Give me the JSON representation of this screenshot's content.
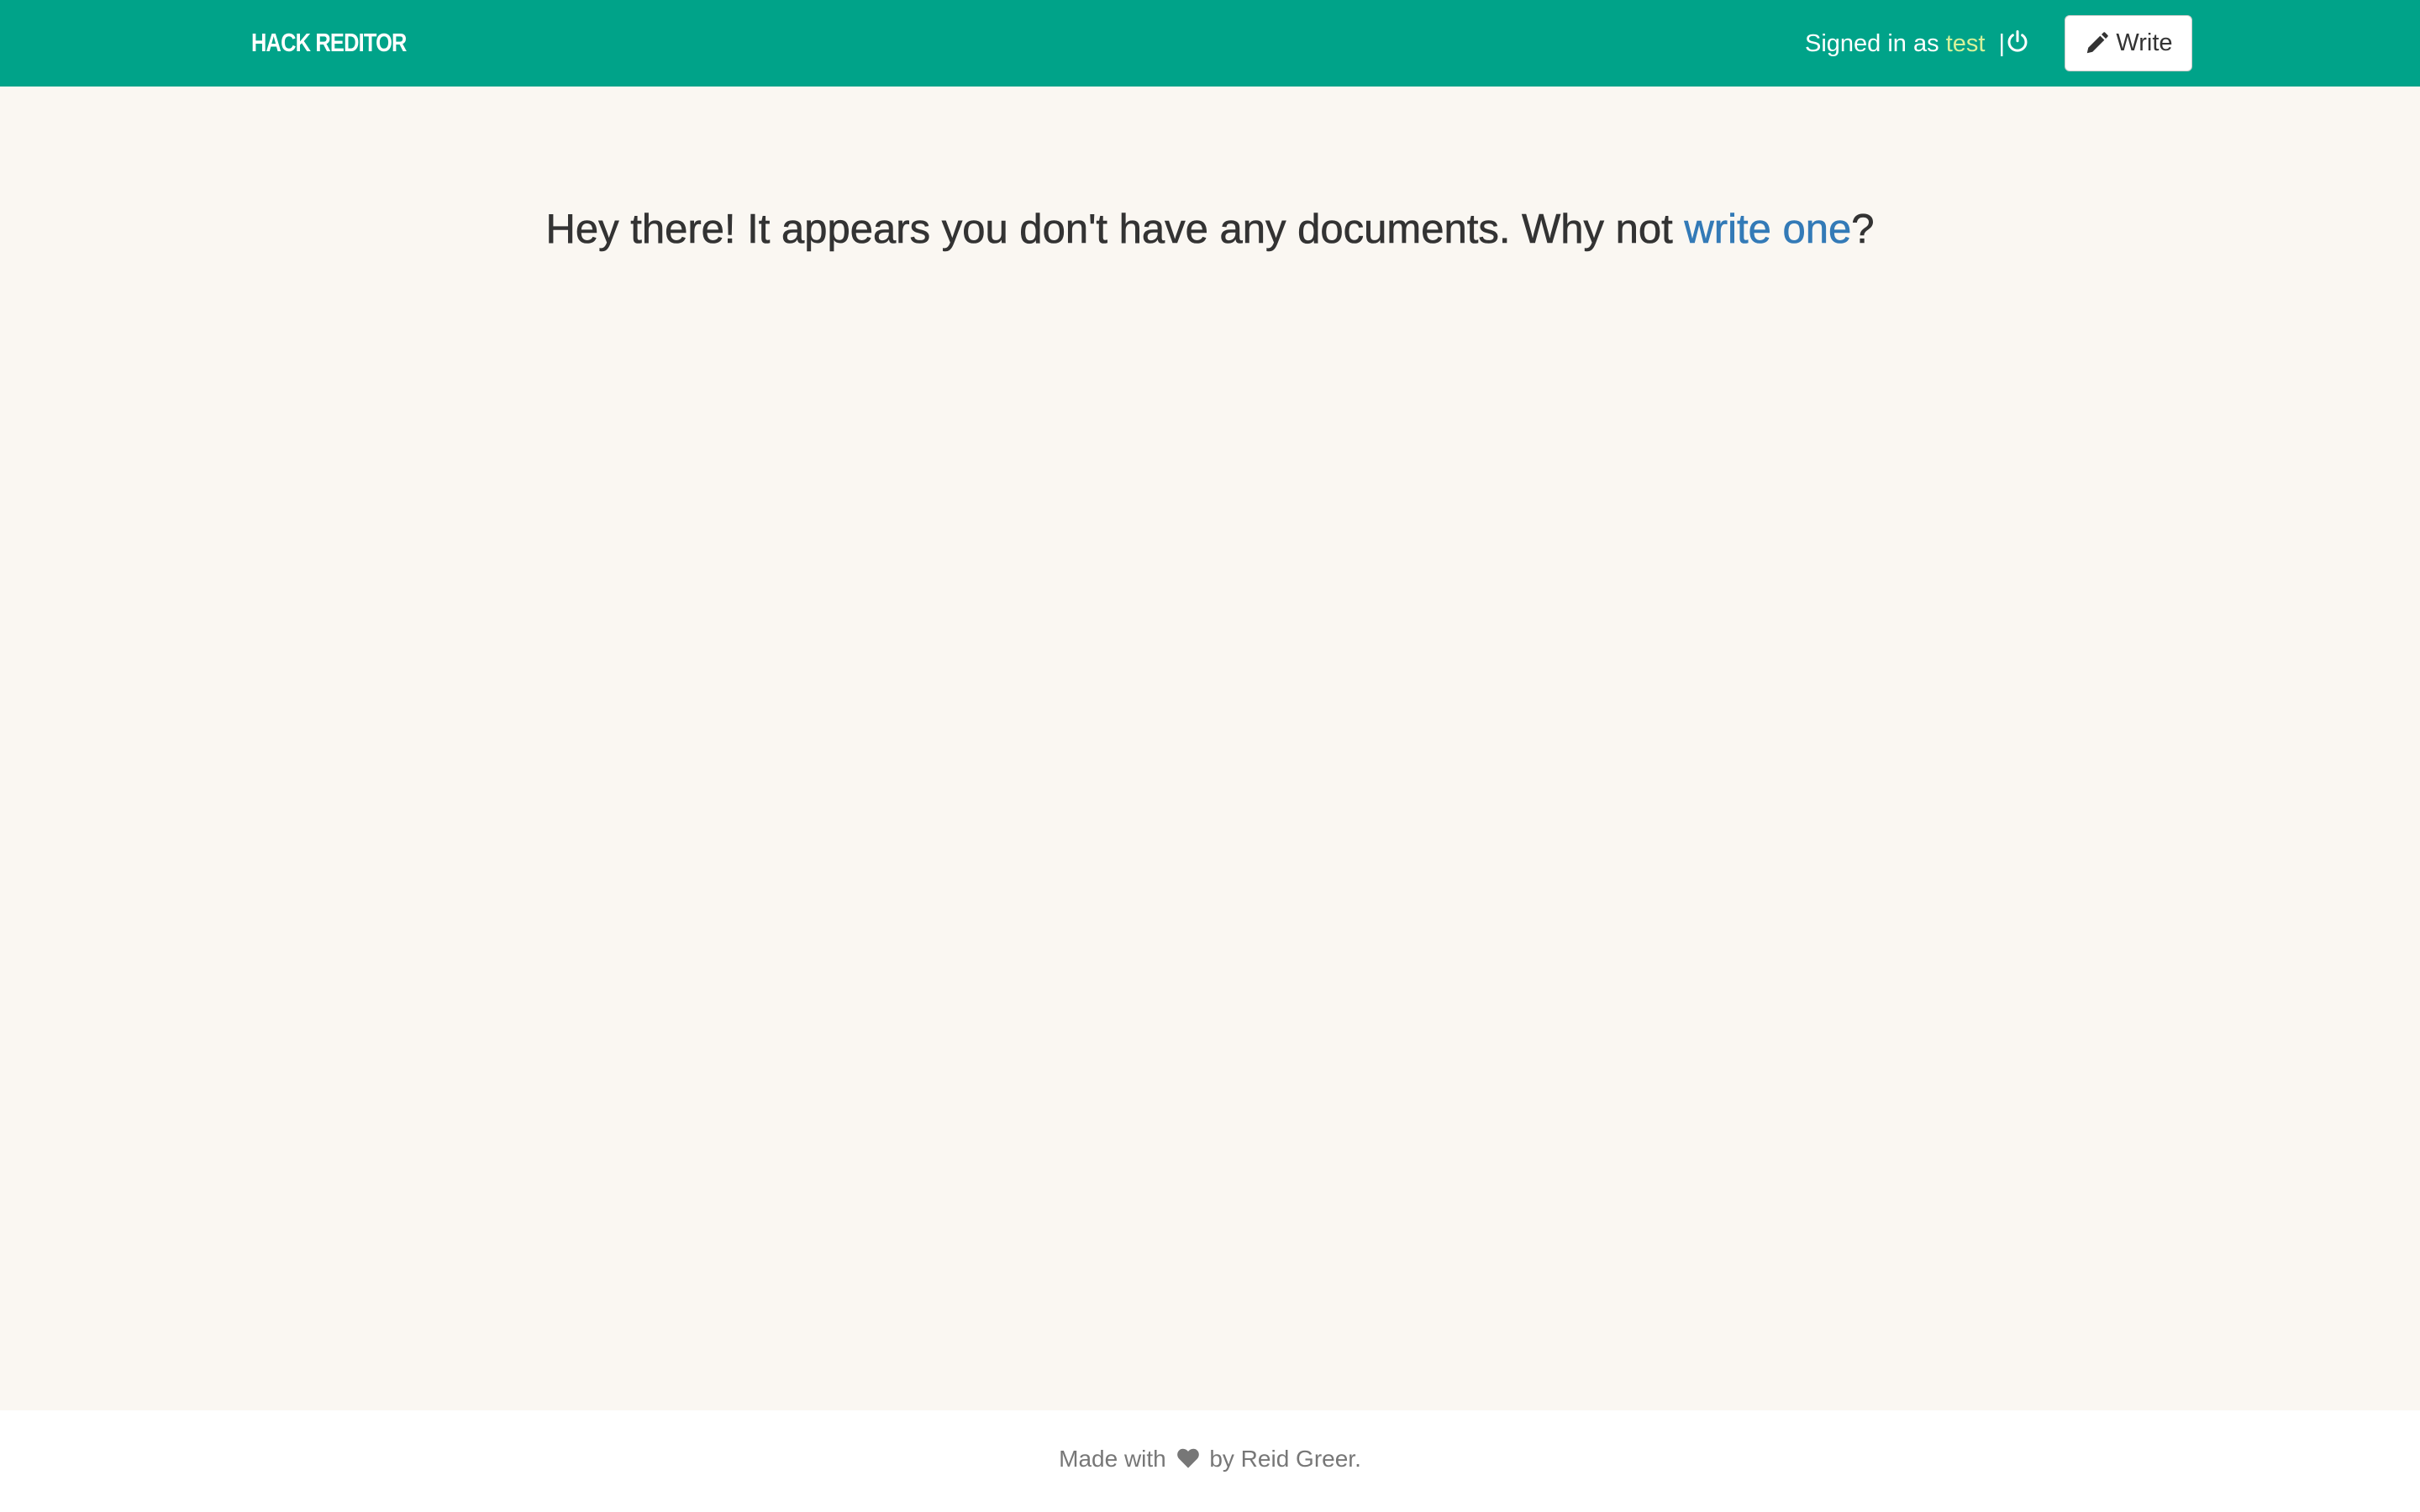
{
  "navbar": {
    "brand": "HACK REDITOR",
    "signed_in_prefix": "Signed in as",
    "username": "test",
    "separator": "|",
    "logout_icon": "power-icon",
    "write_label": "Write",
    "write_icon": "pencil-icon",
    "background_color": "#00a389",
    "username_color": "#d6f19a"
  },
  "main": {
    "message_before": "Hey there! It appears you don't have any documents. Why not ",
    "message_link": "write one",
    "message_after": "?",
    "link_color": "#337ab7",
    "background_color": "#faf7f2"
  },
  "footer": {
    "made_with": "Made with",
    "heart_icon": "heart-icon",
    "by_text": "by Reid Greer."
  }
}
